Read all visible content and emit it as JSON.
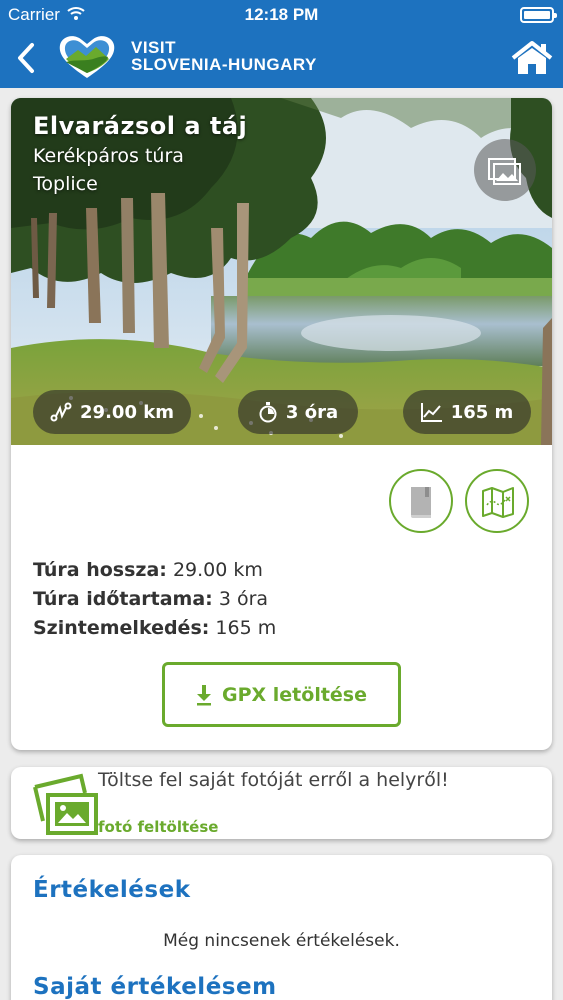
{
  "status_bar": {
    "carrier": "Carrier",
    "time": "12:18 PM",
    "wifi_icon": "wifi-icon",
    "battery_icon": "battery-icon"
  },
  "nav": {
    "back_icon": "back-chevron-icon",
    "logo_icon": "visit-logo-heart-icon",
    "brand_line1": "VISIT",
    "brand_line2": "SLOVENIA-HUNGARY",
    "home_icon": "home-icon"
  },
  "tour": {
    "title": "Elvarázsol a táj",
    "type": "Kerékpáros túra",
    "location": "Toplice",
    "gallery_icon": "gallery-icon",
    "stats": [
      {
        "icon": "route-icon",
        "value": "29.00 km"
      },
      {
        "icon": "stopwatch-icon",
        "value": "3 óra"
      },
      {
        "icon": "elevation-chart-icon",
        "value": "165 m"
      }
    ],
    "action_icons": [
      "book-icon",
      "map-icon"
    ],
    "details": [
      {
        "label": "Túra hossza:",
        "value": "29.00 km"
      },
      {
        "label": "Túra időtartama:",
        "value": "3 óra"
      },
      {
        "label": "Szintemelkedés:",
        "value": "165 m"
      }
    ],
    "gpx_button": "GPX letöltése"
  },
  "upload": {
    "prompt": "Töltse fel saját fotóját erről a helyről!",
    "link": "fotó feltöltése"
  },
  "ratings": {
    "title": "Értékelések",
    "empty": "Még nincsenek értékelések.",
    "own_title": "Saját értékelésem"
  },
  "colors": {
    "brand_blue": "#1d72bf",
    "accent_green": "#6aaa2d",
    "background": "#ececec"
  }
}
